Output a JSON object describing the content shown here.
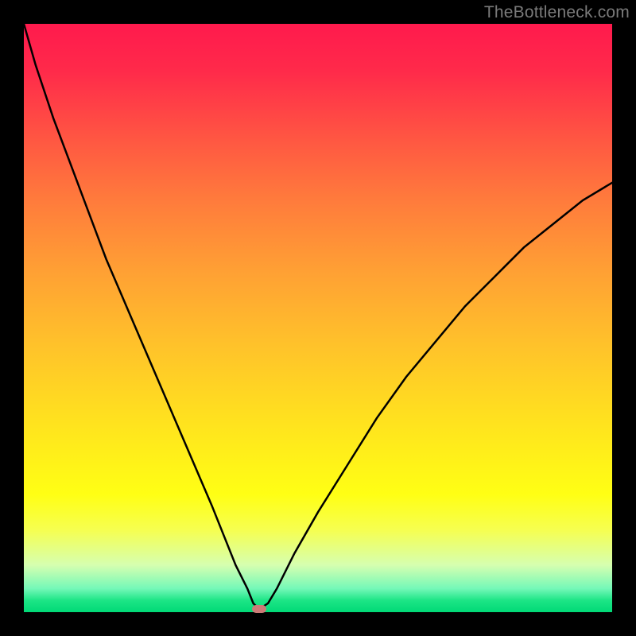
{
  "watermark": "TheBottleneck.com",
  "chart_data": {
    "type": "line",
    "title": "",
    "xlabel": "",
    "ylabel": "",
    "xlim": [
      0,
      100
    ],
    "ylim": [
      0,
      100
    ],
    "grid": false,
    "notch": {
      "x_percent": 40,
      "y_percent": 0.5
    },
    "background_gradient": {
      "from": "#ff1a4d",
      "to": "#00d976",
      "meaning": "bottleneck severity: red=high, green=optimal"
    },
    "curve_description": "V-shaped bottleneck curve dipping to near-zero at ~40% on x-axis; steep on the left, shallower on the right, rising to ~73% at x=100",
    "series": [
      {
        "name": "bottleneck_percent",
        "x": [
          0,
          2,
          5,
          8,
          11,
          14,
          17,
          20,
          23,
          26,
          29,
          32,
          34,
          36,
          38,
          39,
          40,
          41.5,
          43,
          46,
          50,
          55,
          60,
          65,
          70,
          75,
          80,
          85,
          90,
          95,
          100
        ],
        "values": [
          100,
          93,
          84,
          76,
          68,
          60,
          53,
          46,
          39,
          32,
          25,
          18,
          13,
          8,
          4,
          1.5,
          0.5,
          1.5,
          4,
          10,
          17,
          25,
          33,
          40,
          46,
          52,
          57,
          62,
          66,
          70,
          73
        ]
      }
    ]
  }
}
